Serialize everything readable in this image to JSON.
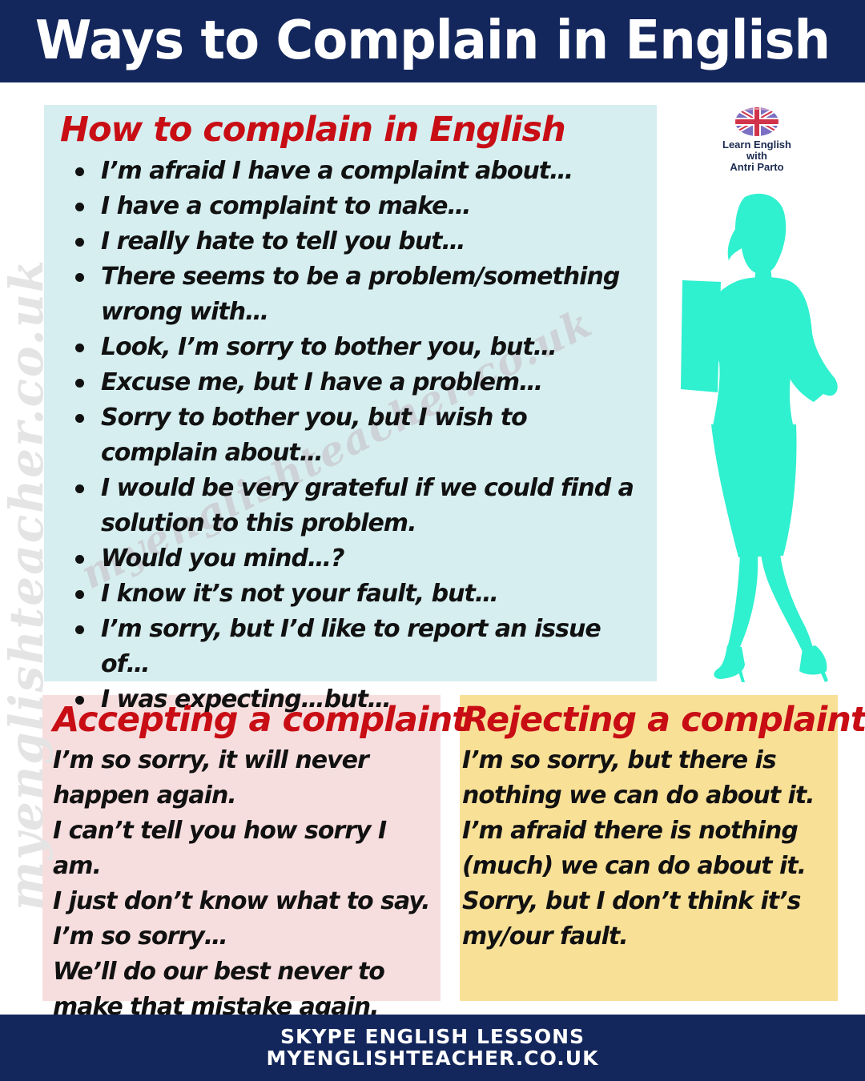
{
  "header": {
    "title": "Ways to Complain in English"
  },
  "logo": {
    "line1": "Learn English",
    "line2": "with",
    "line3": "Antri Parto"
  },
  "watermark": {
    "vertical": "myenglishteacher.co.uk",
    "diagonal": "myenglishteacher.co.uk"
  },
  "complain": {
    "heading": "How to complain in English",
    "items": [
      "I’m afraid I have a complaint about…",
      "I have a complaint to make…",
      "I really hate to tell you but…",
      "There seems to be a problem/something wrong with…",
      "Look, I’m sorry to bother you, but…",
      "Excuse me, but I have a problem…",
      "Sorry to bother you, but I wish to complain about…",
      "I would be very grateful if we could find a solution to this problem.",
      "Would you mind…?",
      "I know it’s not your fault, but…",
      "I’m sorry, but I’d like to report an issue of…",
      "I was expecting…but…"
    ]
  },
  "accepting": {
    "heading": "Accepting a complaint",
    "items": [
      "I’m so sorry, it will never happen again.",
      "I can’t tell you how sorry I am.",
      "I just don’t know what to say.",
      "I’m so sorry…",
      "We’ll do our best never to make that mistake again."
    ]
  },
  "rejecting": {
    "heading": "Rejecting a complaint",
    "items": [
      "I’m so sorry, but there is nothing we can do about it.",
      "I’m afraid there is nothing (much) we can do about it.",
      "Sorry, but I don’t think it’s my/our fault."
    ]
  },
  "footer": {
    "line1": "SKYPE ENGLISH LESSONS",
    "line2": "MYENGLISHTEACHER.CO.UK"
  },
  "colors": {
    "navy": "#14275c",
    "heading_red": "#c80d14",
    "main_box": "#d6eef0",
    "accept_box": "#f7dede",
    "reject_box": "#f8e097",
    "silhouette": "#2ff0cf"
  }
}
